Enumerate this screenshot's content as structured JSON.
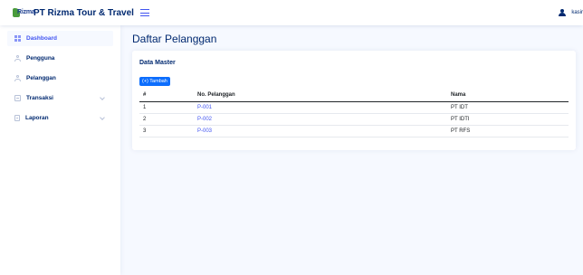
{
  "header": {
    "logo_mark": "Rizma",
    "brand": "PT Rizma Tour & Travel",
    "menu_icon": "hamburger-icon",
    "user_icon": "user-icon",
    "user_name": "kasir"
  },
  "sidebar": {
    "items": [
      {
        "label": "Dashboard",
        "icon": "grid-icon",
        "active": true
      },
      {
        "label": "Pengguna",
        "icon": "person-icon"
      },
      {
        "label": "Pelanggan",
        "icon": "person-icon"
      },
      {
        "label": "Transaksi",
        "icon": "card-icon",
        "chevron": "chevron-down-icon"
      },
      {
        "label": "Laporan",
        "icon": "document-icon",
        "chevron": "chevron-down-icon"
      }
    ]
  },
  "main": {
    "title": "Daftar Pelanggan",
    "card_title": "Data Master",
    "add_button": "(+) Tambah",
    "table": {
      "headers": [
        "#",
        "No. Pelanggan",
        "Nama"
      ],
      "rows": [
        {
          "no": "1",
          "id": "P-001",
          "name": "PT IDT"
        },
        {
          "no": "2",
          "id": "P-002",
          "name": "PT IDTI"
        },
        {
          "no": "3",
          "id": "P-003",
          "name": "PT RFS"
        }
      ]
    }
  },
  "colors": {
    "accent": "#4154f1",
    "primary_button": "#0d6efd",
    "text_dark": "#012970",
    "page_bg": "#f6f9ff"
  }
}
